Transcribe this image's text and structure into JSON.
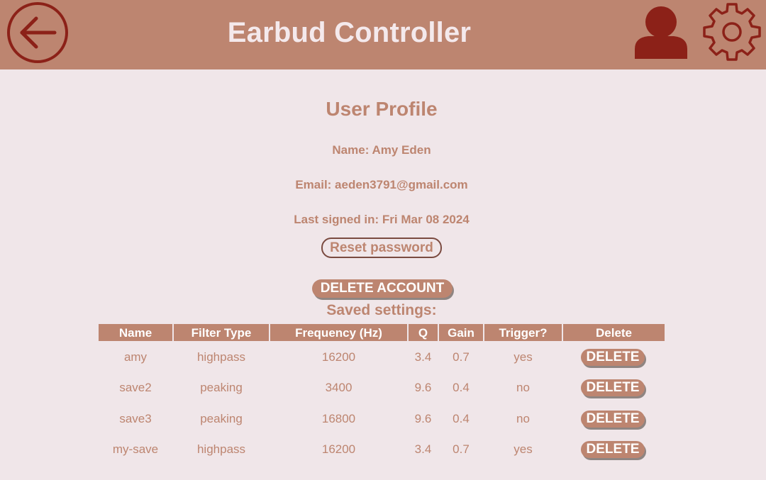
{
  "header": {
    "title": "Earbud Controller",
    "back_icon": "arrow-left-circle-icon",
    "user_icon": "user-icon",
    "settings_icon": "gear-icon"
  },
  "profile": {
    "title": "User Profile",
    "name": "Name: Amy Eden",
    "email": "Email: aeden3791@gmail.com",
    "last_signed_in": "Last signed in: Fri Mar 08 2024",
    "reset_password_label": "Reset password",
    "delete_account_label": "DELETE ACCOUNT"
  },
  "saved": {
    "title": "Saved settings:",
    "columns": [
      "Name",
      "Filter Type",
      "Frequency (Hz)",
      "Q",
      "Gain",
      "Trigger?",
      "Delete"
    ],
    "delete_label": "DELETE",
    "rows": [
      {
        "name": "amy",
        "filter_type": "highpass",
        "frequency": "16200",
        "q": "3.4",
        "gain": "0.7",
        "trigger": "yes"
      },
      {
        "name": "save2",
        "filter_type": "peaking",
        "frequency": "3400",
        "q": "9.6",
        "gain": "0.4",
        "trigger": "no"
      },
      {
        "name": "save3",
        "filter_type": "peaking",
        "frequency": "16800",
        "q": "9.6",
        "gain": "0.4",
        "trigger": "no"
      },
      {
        "name": "my-save",
        "filter_type": "highpass",
        "frequency": "16200",
        "q": "3.4",
        "gain": "0.7",
        "trigger": "yes"
      }
    ]
  },
  "colors": {
    "header_bg": "#bd8570",
    "page_bg": "#f0e6e9",
    "icon": "#8c2118",
    "accent_text": "#bd8570"
  }
}
